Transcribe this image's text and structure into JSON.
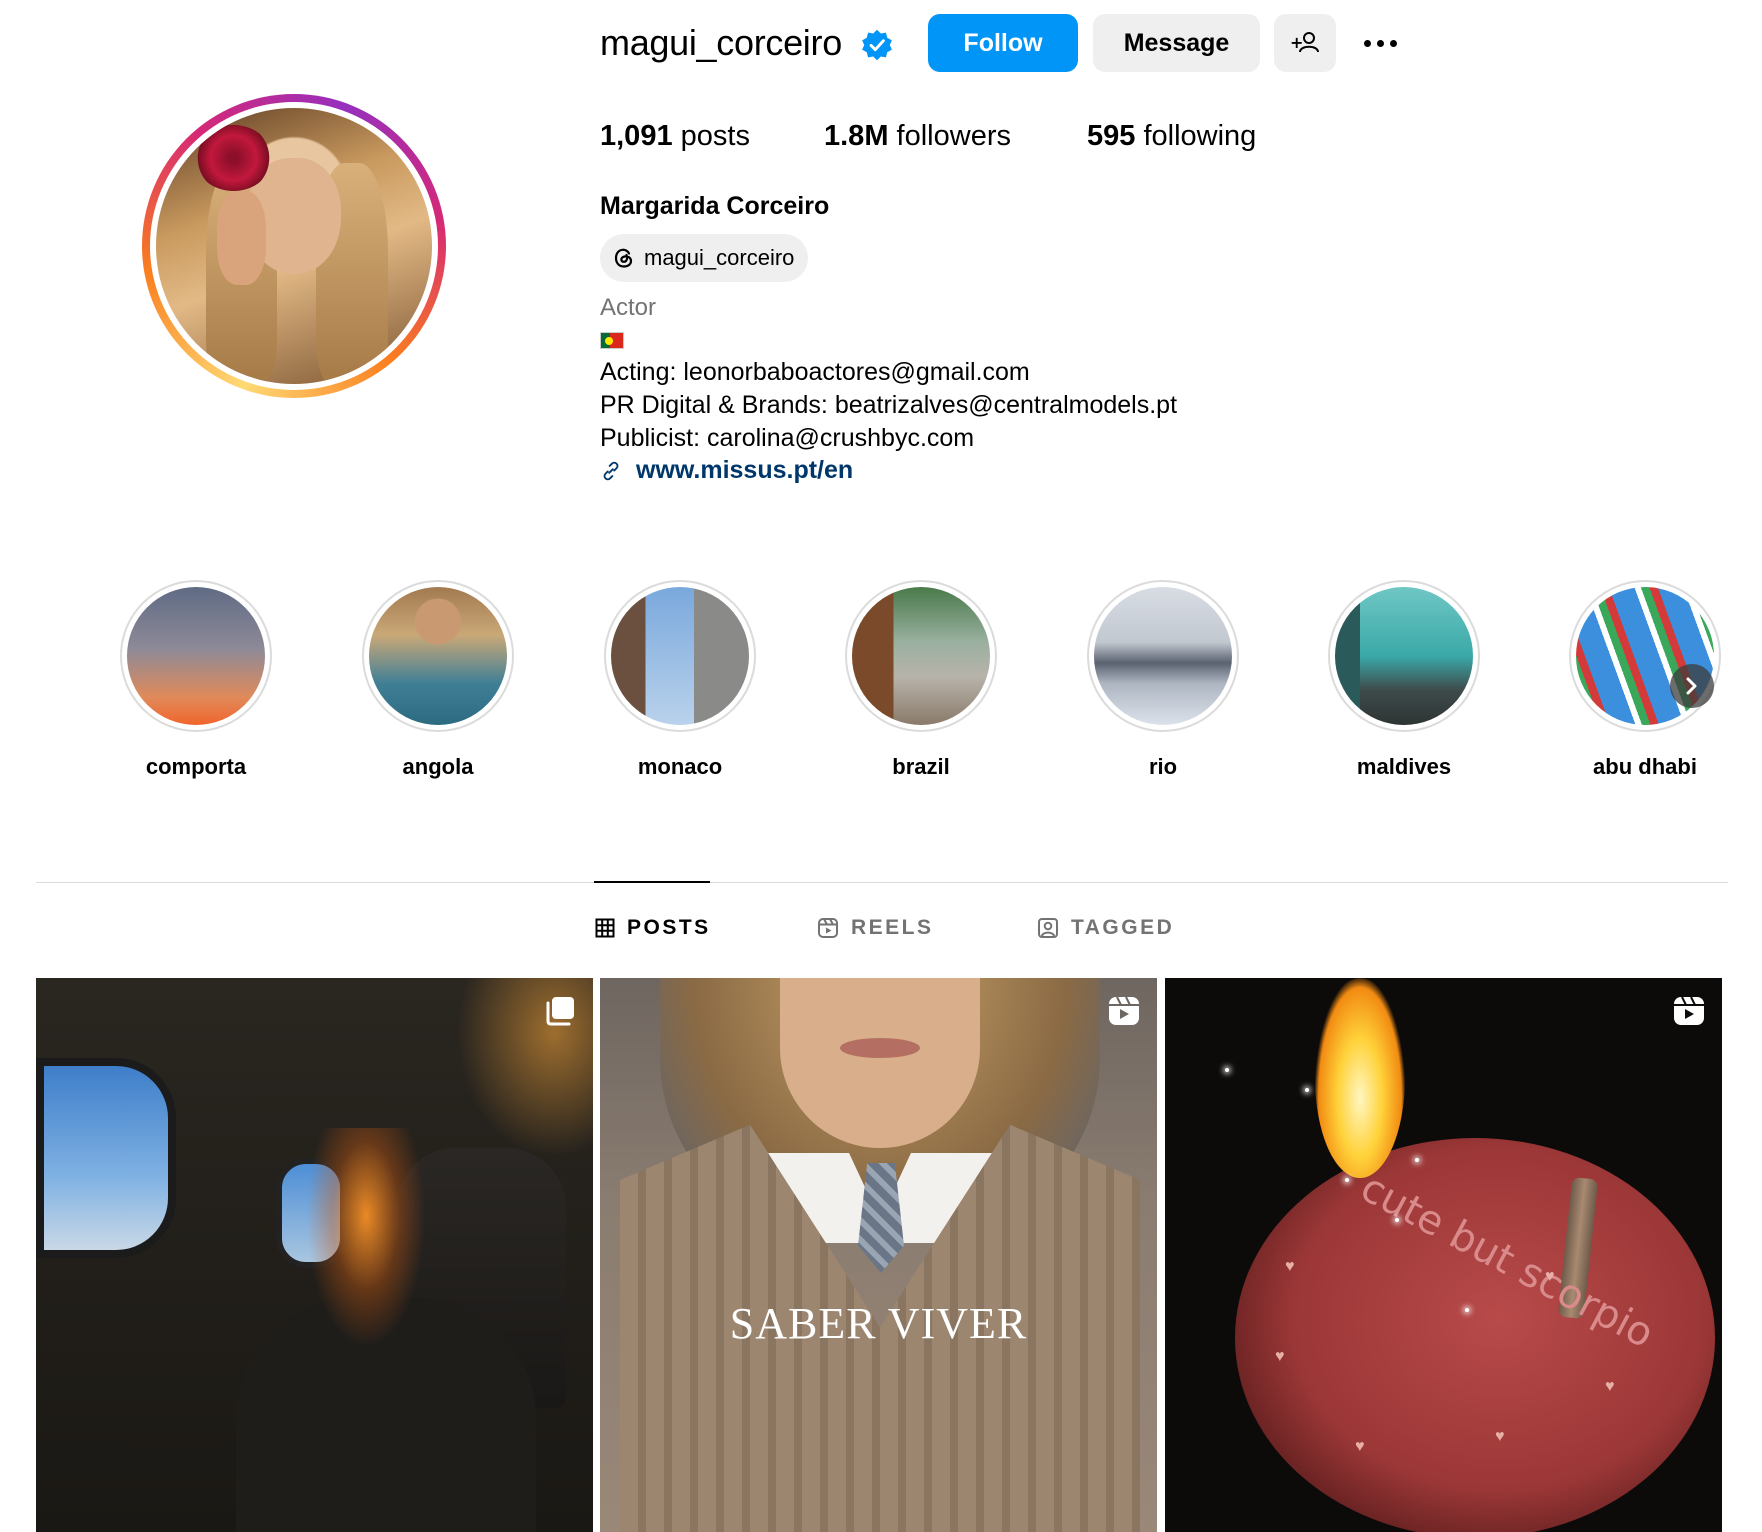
{
  "profile": {
    "username": "magui_corceiro",
    "verified_icon": "verified-badge-icon",
    "follow_label": "Follow",
    "message_label": "Message",
    "posts_count": "1,091",
    "posts_label": "posts",
    "followers_count": "1.8M",
    "followers_label": "followers",
    "following_count": "595",
    "following_label": "following",
    "full_name": "Margarida Corceiro",
    "threads_handle": "magui_corceiro",
    "category": "Actor",
    "bio": [
      "Acting: leonorbaboactores@gmail.com",
      "PR Digital & Brands: beatrizalves@centralmodels.pt",
      "Publicist: carolina@crushbyc.com"
    ],
    "link": "www.missus.pt/en"
  },
  "highlights": [
    {
      "label": "comporta"
    },
    {
      "label": "angola"
    },
    {
      "label": "monaco"
    },
    {
      "label": "brazil"
    },
    {
      "label": "rio"
    },
    {
      "label": "maldives"
    },
    {
      "label": "abu dhabi"
    }
  ],
  "tabs": [
    {
      "label": "POSTS",
      "icon": "grid-icon",
      "active": true
    },
    {
      "label": "REELS",
      "icon": "reels-icon",
      "active": false
    },
    {
      "label": "TAGGED",
      "icon": "tagged-icon",
      "active": false
    }
  ],
  "posts": [
    {
      "type_icon": "carousel-icon"
    },
    {
      "type_icon": "reel-icon",
      "overlay_text": "SABER VIVER"
    },
    {
      "type_icon": "reel-icon",
      "cake_text": "cute but scorpio"
    }
  ],
  "colors": {
    "follow_button": "#0095f6",
    "secondary_button": "#efefef",
    "link": "#00376b",
    "muted_text": "#737373",
    "verified": "#0095f6"
  }
}
